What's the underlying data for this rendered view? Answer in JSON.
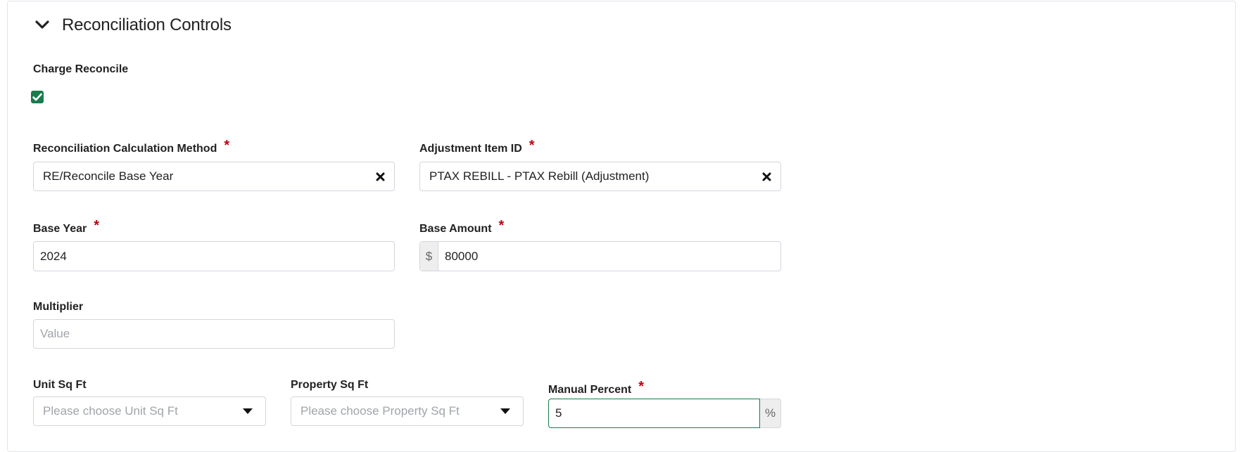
{
  "section": {
    "title": "Reconciliation Controls",
    "toggle_icon": "chevron-down-icon"
  },
  "charge_reconcile": {
    "label": "Charge Reconcile",
    "checked": true
  },
  "calc_method": {
    "label": "Reconciliation Calculation Method",
    "required_mark": "*",
    "value": "RE/Reconcile Base Year"
  },
  "adjustment_item": {
    "label": "Adjustment Item ID",
    "required_mark": "*",
    "value": "PTAX REBILL - PTAX Rebill (Adjustment)"
  },
  "base_year": {
    "label": "Base Year",
    "required_mark": "*",
    "value": "2024"
  },
  "base_amount": {
    "label": "Base Amount",
    "required_mark": "*",
    "prefix": "$",
    "value": "80000"
  },
  "multiplier": {
    "label": "Multiplier",
    "placeholder": "Value",
    "value": ""
  },
  "unit_sqft": {
    "label": "Unit Sq Ft",
    "placeholder": "Please choose Unit Sq Ft"
  },
  "property_sqft": {
    "label": "Property Sq Ft",
    "placeholder": "Please choose Property Sq Ft"
  },
  "manual_percent": {
    "label": "Manual Percent",
    "required_mark": "*",
    "value": "5",
    "suffix": "%"
  },
  "colors": {
    "accent": "#187c4c",
    "required": "#c40010",
    "border": "#d3d6dc"
  }
}
